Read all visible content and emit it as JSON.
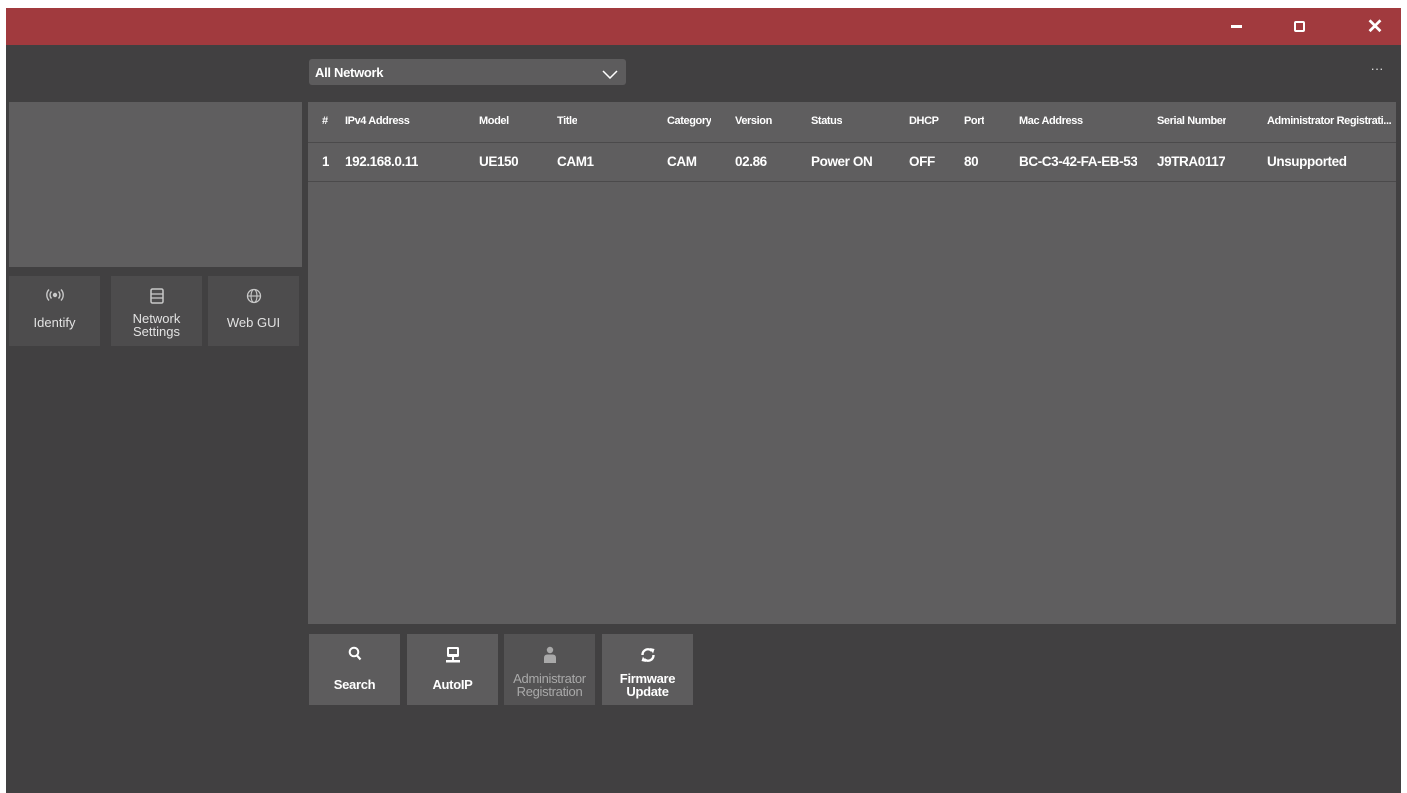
{
  "window": {
    "controls": {
      "minimize": "minimize-icon",
      "maximize": "restore-icon",
      "close": "close-icon"
    },
    "accent_color": "#a13a3e",
    "close_glyph": "✕"
  },
  "toolbar": {
    "network_select": "All Network",
    "more_label": "···"
  },
  "sidebar": {
    "buttons": [
      {
        "label": "Identify",
        "icon": "identify-broadcast-icon"
      },
      {
        "label": "Network\nSettings",
        "icon": "network-settings-icon"
      },
      {
        "label": "Web GUI",
        "icon": "globe-icon"
      }
    ]
  },
  "table": {
    "columns": [
      "#",
      "IPv4 Address",
      "Model",
      "Title",
      "Category",
      "Version",
      "Status",
      "DHCP",
      "Port",
      "Mac Address",
      "Serial Number",
      "Administrator Registrati..."
    ],
    "rows": [
      [
        "1",
        "192.168.0.11",
        "UE150",
        "CAM1",
        "CAM",
        "02.86",
        "Power ON",
        "OFF",
        "80",
        "BC-C3-42-FA-EB-53",
        "J9TRA0117",
        "Unsupported"
      ]
    ]
  },
  "actions": [
    {
      "label": "Search",
      "icon": "search-icon",
      "enabled": true
    },
    {
      "label": "AutoIP",
      "icon": "autoip-monitor-icon",
      "enabled": true
    },
    {
      "label": "Administrator\nRegistration",
      "icon": "user-icon",
      "enabled": false
    },
    {
      "label": "Firmware\nUpdate",
      "icon": "refresh-icon",
      "enabled": true
    }
  ]
}
